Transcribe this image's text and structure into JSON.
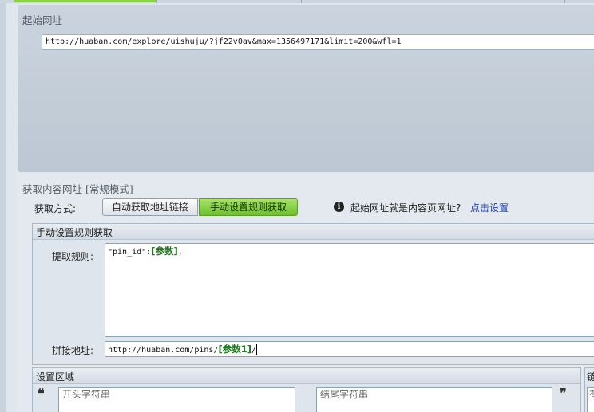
{
  "start_url": {
    "title": "起始网址",
    "value": "http://huaban.com/explore/uishuju/?jf22v0av&max=1356497171&limit=200&wfl=1"
  },
  "content_url": {
    "title": "获取内容网址 [常规模式]",
    "method_label": "获取方式:",
    "auto_option": "自动获取地址链接",
    "manual_option": "手动设置规则获取",
    "hint": "起始网址就是内容页网址?",
    "hint_link": "点击设置"
  },
  "manual_rules": {
    "title": "手动设置规则获取",
    "extract_label": "提取规则:",
    "extract_prefix": "\"pin_id\":",
    "extract_param": "[参数]",
    "extract_suffix": ",",
    "concat_label": "拼接地址:",
    "concat_prefix": "http://huaban.com/pins/",
    "concat_param": "[参数1]",
    "concat_suffix": "/"
  },
  "region": {
    "title": "设置区域",
    "open_quote": "❝",
    "close_quote": "❞",
    "start_placeholder": "开头字符串",
    "end_placeholder": "结尾字符串",
    "right_panel_title": "链",
    "right_input_text": "有"
  },
  "colors": {
    "active_tab": "#8bd246",
    "active_segment": "#6cc02c",
    "param_green": "#1d7a1d",
    "link_blue": "#1a3fb8"
  }
}
